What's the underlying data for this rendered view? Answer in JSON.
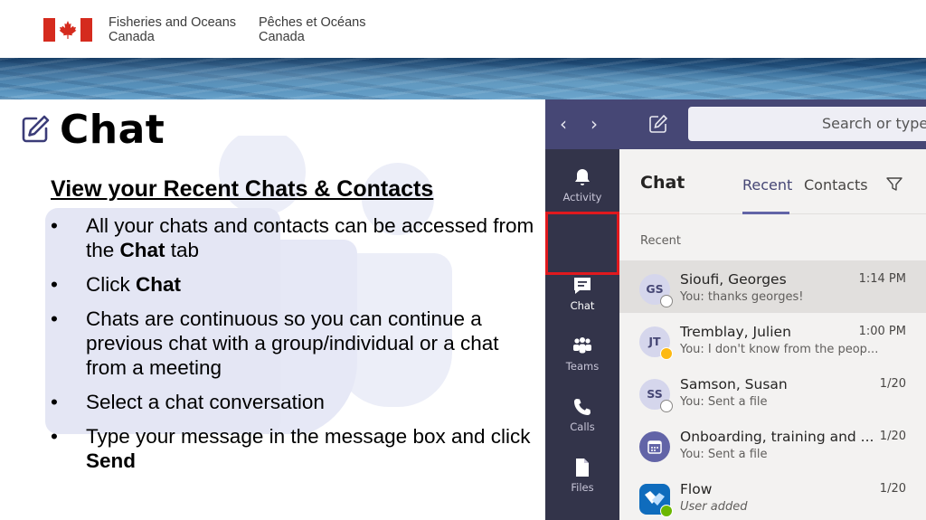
{
  "header": {
    "dept_en_line1": "Fisheries and Oceans",
    "dept_en_line2": "Canada",
    "dept_fr_line1": "Pêches et Océans",
    "dept_fr_line2": "Canada"
  },
  "slide": {
    "title": "Chat",
    "subheading": "View your Recent Chats & Contacts",
    "bullets": [
      {
        "pre": "All your chats and contacts can be accessed from the ",
        "bold": "Chat",
        "post": " tab"
      },
      {
        "pre": "Click ",
        "bold": "Chat",
        "post": ""
      },
      {
        "pre": "Chats are continuous so you can continue a previous chat with a group/individual or a chat from a meeting",
        "bold": "",
        "post": ""
      },
      {
        "pre": "Select a chat conversation",
        "bold": "",
        "post": ""
      },
      {
        "pre": "Type your message in the message box and click ",
        "bold": "Send",
        "post": ""
      }
    ]
  },
  "teams": {
    "search_placeholder": "Search or type a",
    "rail": [
      {
        "label": "Activity",
        "icon": "bell-icon"
      },
      {
        "label": "Chat",
        "icon": "chat-icon"
      },
      {
        "label": "Teams",
        "icon": "teams-icon"
      },
      {
        "label": "Calls",
        "icon": "phone-icon"
      },
      {
        "label": "Files",
        "icon": "file-icon"
      }
    ],
    "list_title": "Chat",
    "tabs": {
      "recent": "Recent",
      "contacts": "Contacts"
    },
    "section_label": "Recent",
    "chats": [
      {
        "initials": "GS",
        "name": "Sioufi, Georges",
        "time": "1:14 PM",
        "preview": "You: thanks georges!"
      },
      {
        "initials": "JT",
        "name": "Tremblay, Julien",
        "time": "1:00 PM",
        "preview": "You: I don't know from the peop..."
      },
      {
        "initials": "SS",
        "name": "Samson, Susan",
        "time": "1/20",
        "preview": "You: Sent a file"
      },
      {
        "initials": "",
        "name": "Onboarding, training and ...",
        "time": "1/20",
        "preview": "You: Sent a file"
      },
      {
        "initials": "",
        "name": "Flow",
        "time": "1/20",
        "preview": "User added"
      }
    ]
  },
  "colors": {
    "teams_purple": "#464775",
    "rail_dark": "#33344a",
    "highlight_red": "#e0191e",
    "flag_red": "#d52b1e"
  }
}
